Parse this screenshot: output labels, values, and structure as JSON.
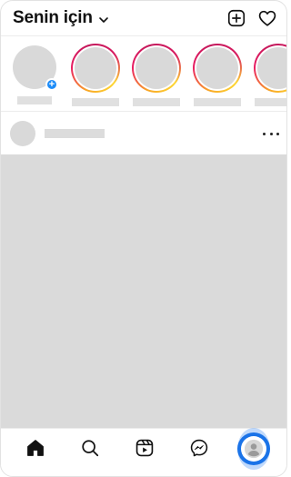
{
  "header": {
    "title": "Senin için",
    "title_icon": "chevron-down-icon",
    "actions": [
      "new-post-icon",
      "heart-icon"
    ]
  },
  "stories": {
    "items": [
      {
        "type": "own",
        "badge": "+"
      },
      {
        "type": "ring"
      },
      {
        "type": "ring"
      },
      {
        "type": "ring"
      },
      {
        "type": "ring"
      }
    ],
    "ring_colors": [
      "#f9a825",
      "#e91e63",
      "#c2185b"
    ]
  },
  "post": {
    "more_icon": "more-horizontal-icon"
  },
  "bottom_nav": {
    "items": [
      "home-icon",
      "search-icon",
      "reels-icon",
      "messenger-icon",
      "profile-icon"
    ],
    "active_highlight": "#1a73e8"
  }
}
